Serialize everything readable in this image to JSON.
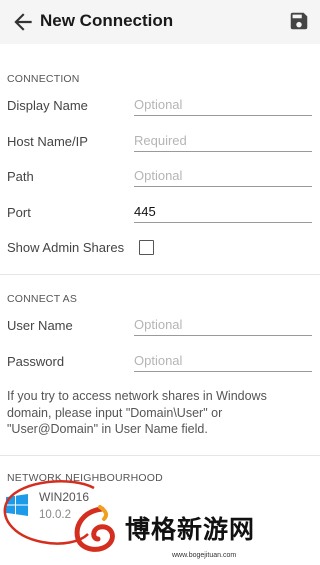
{
  "appbar": {
    "title": "New Connection"
  },
  "connection": {
    "section_label": "CONNECTION",
    "display_name": {
      "label": "Display Name",
      "placeholder": "Optional",
      "value": ""
    },
    "host": {
      "label": "Host Name/IP",
      "placeholder": "Required",
      "value": ""
    },
    "path": {
      "label": "Path",
      "placeholder": "Optional",
      "value": ""
    },
    "port": {
      "label": "Port",
      "placeholder": "",
      "value": "445"
    },
    "admin_shares": {
      "label": "Show Admin Shares",
      "checked": false
    }
  },
  "connect_as": {
    "section_label": "CONNECT AS",
    "user_name": {
      "label": "User Name",
      "placeholder": "Optional",
      "value": ""
    },
    "password": {
      "label": "Password",
      "placeholder": "Optional",
      "value": ""
    },
    "note": "If you try to access network shares in Windows domain, please input \"Domain\\User\" or \"User@Domain\" in User Name field."
  },
  "neighbourhood": {
    "section_label": "NETWORK NEIGHBOURHOOD",
    "devices": [
      {
        "name": "WIN2016",
        "version": "10.0.2",
        "icon": "windows-icon"
      }
    ]
  },
  "watermark": {
    "text": "博格新游网",
    "url": "www.bogejituan.com"
  },
  "colors": {
    "appbar_bg": "#f5f5f5",
    "windows_blue": "#1e9be8",
    "watermark_red": "#d42e1f",
    "watermark_orange": "#f0a020"
  }
}
